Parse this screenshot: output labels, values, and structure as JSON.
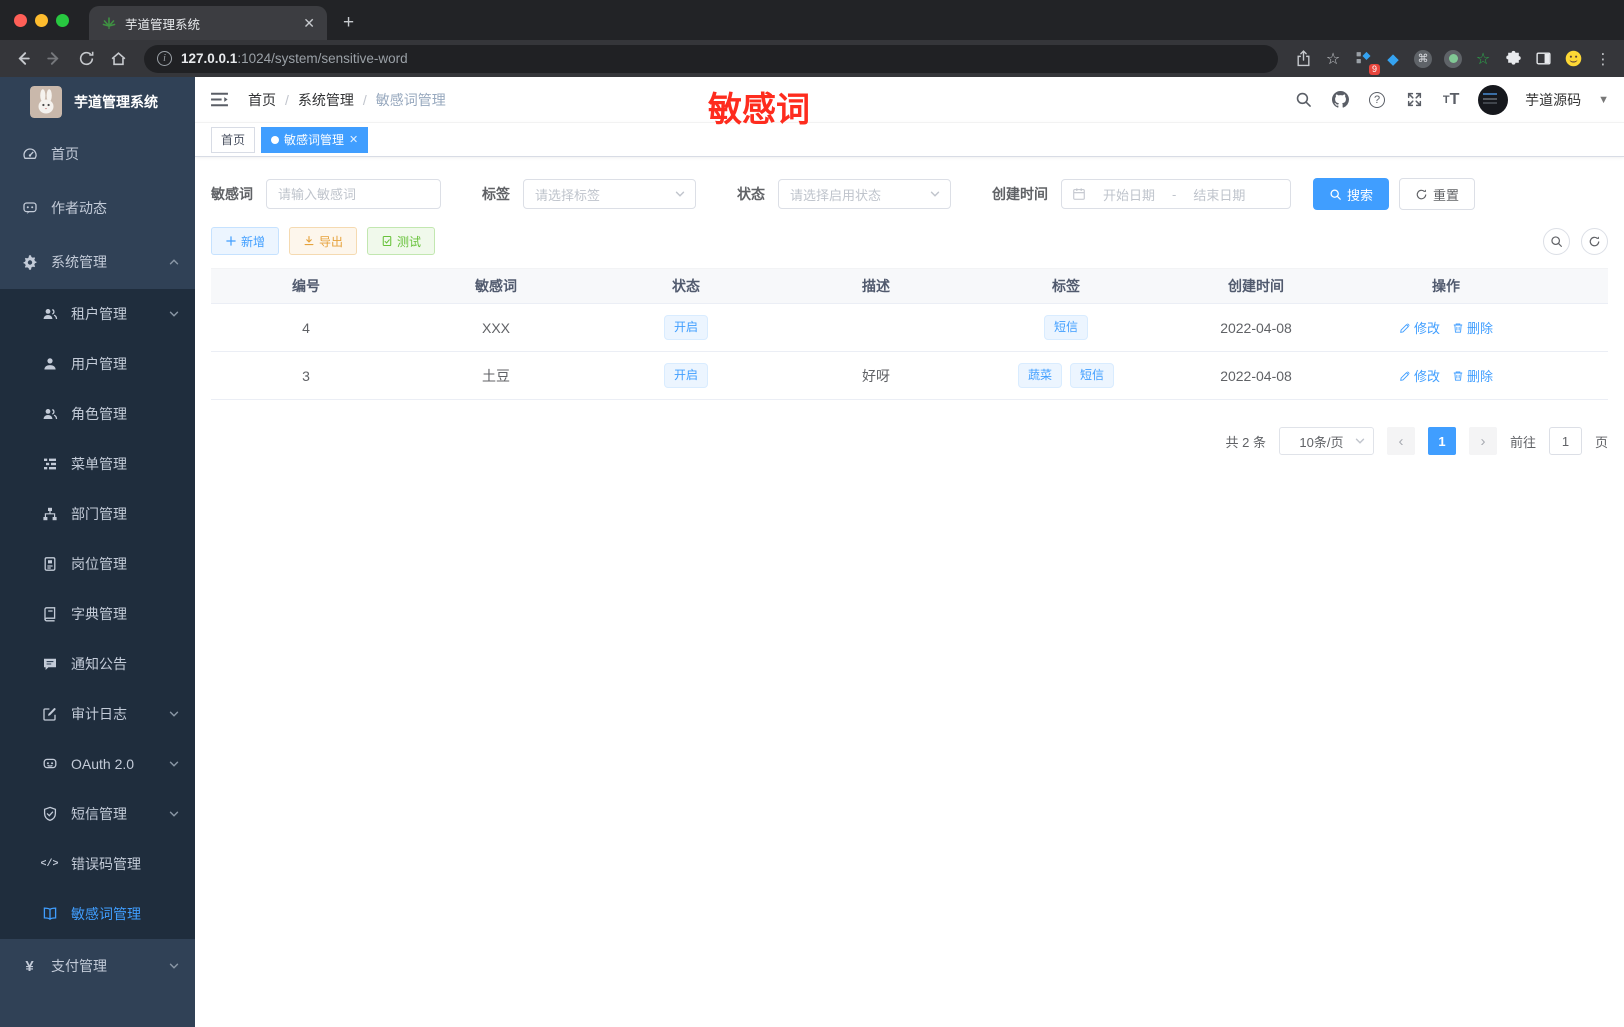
{
  "browser": {
    "tab_title": "芋道管理系统",
    "url_host": "127.0.0.1",
    "url_rest": ":1024/system/sensitive-word",
    "extension_badge": "9"
  },
  "sidebar": {
    "app_title": "芋道管理系统",
    "items": [
      {
        "key": "home",
        "icon": "dashboard-icon",
        "label": "首页",
        "level": "top"
      },
      {
        "key": "author-news",
        "icon": "chat-icon",
        "label": "作者动态",
        "level": "top"
      },
      {
        "key": "system",
        "icon": "gear-icon",
        "label": "系统管理",
        "level": "top",
        "chevron": "up"
      },
      {
        "key": "tenant",
        "icon": "users-icon",
        "label": "租户管理",
        "level": "sub",
        "chevron": "down"
      },
      {
        "key": "user",
        "icon": "user-icon",
        "label": "用户管理",
        "level": "sub"
      },
      {
        "key": "role",
        "icon": "users-icon",
        "label": "角色管理",
        "level": "sub"
      },
      {
        "key": "menu",
        "icon": "tree-list-icon",
        "label": "菜单管理",
        "level": "sub"
      },
      {
        "key": "dept",
        "icon": "org-chart-icon",
        "label": "部门管理",
        "level": "sub"
      },
      {
        "key": "post",
        "icon": "badge-icon",
        "label": "岗位管理",
        "level": "sub"
      },
      {
        "key": "dict",
        "icon": "book-icon",
        "label": "字典管理",
        "level": "sub"
      },
      {
        "key": "notice",
        "icon": "bubble-icon",
        "label": "通知公告",
        "level": "sub"
      },
      {
        "key": "audit-log",
        "icon": "edit-note-icon",
        "label": "审计日志",
        "level": "sub",
        "chevron": "down"
      },
      {
        "key": "oauth",
        "icon": "robot-icon",
        "label": "OAuth 2.0",
        "level": "sub",
        "chevron": "down"
      },
      {
        "key": "sms",
        "icon": "shield-check-icon",
        "label": "短信管理",
        "level": "sub",
        "chevron": "down"
      },
      {
        "key": "error-code",
        "icon": "code-icon",
        "label": "错误码管理",
        "level": "sub"
      },
      {
        "key": "sensitive-word",
        "icon": "open-book-icon",
        "label": "敏感词管理",
        "level": "sub",
        "active": true
      },
      {
        "key": "pay",
        "icon": "yen-icon",
        "label": "支付管理",
        "level": "top",
        "chevron": "down"
      }
    ]
  },
  "header": {
    "breadcrumb": [
      "首页",
      "系统管理",
      "敏感词管理"
    ],
    "username": "芋道源码"
  },
  "annotation": {
    "text": "敏感词",
    "color": "#fe2c1e"
  },
  "tags_view": [
    {
      "label": "首页",
      "active": false,
      "closable": false
    },
    {
      "label": "敏感词管理",
      "active": true,
      "closable": true
    }
  ],
  "filters": {
    "keyword_label": "敏感词",
    "keyword_placeholder": "请输入敏感词",
    "tag_label": "标签",
    "tag_placeholder": "请选择标签",
    "status_label": "状态",
    "status_placeholder": "请选择启用状态",
    "date_label": "创建时间",
    "date_start_placeholder": "开始日期",
    "date_separator": "-",
    "date_end_placeholder": "结束日期",
    "search_label": "搜索",
    "reset_label": "重置"
  },
  "toolbar": {
    "add_label": "新增",
    "export_label": "导出",
    "test_label": "测试"
  },
  "table": {
    "columns": [
      "编号",
      "敏感词",
      "状态",
      "描述",
      "标签",
      "创建时间",
      "操作"
    ],
    "rows": [
      {
        "id": "4",
        "word": "XXX",
        "status": "开启",
        "desc": "",
        "tags": [
          "短信"
        ],
        "created": "2022-04-08"
      },
      {
        "id": "3",
        "word": "土豆",
        "status": "开启",
        "desc": "好呀",
        "tags": [
          "蔬菜",
          "短信"
        ],
        "created": "2022-04-08"
      }
    ],
    "edit_label": "修改",
    "delete_label": "删除"
  },
  "pagination": {
    "total": "共 2 条",
    "page_size": "10条/页",
    "current_page": "1",
    "goto_label": "前往",
    "goto_value": "1",
    "page_unit": "页"
  },
  "colors": {
    "primary": "#409eff",
    "sidebar_bg": "#304156",
    "submenu_bg": "#1f2d3d",
    "annotation_red": "#fe2c1e",
    "warning": "#e6a23c",
    "success": "#67c23a"
  }
}
